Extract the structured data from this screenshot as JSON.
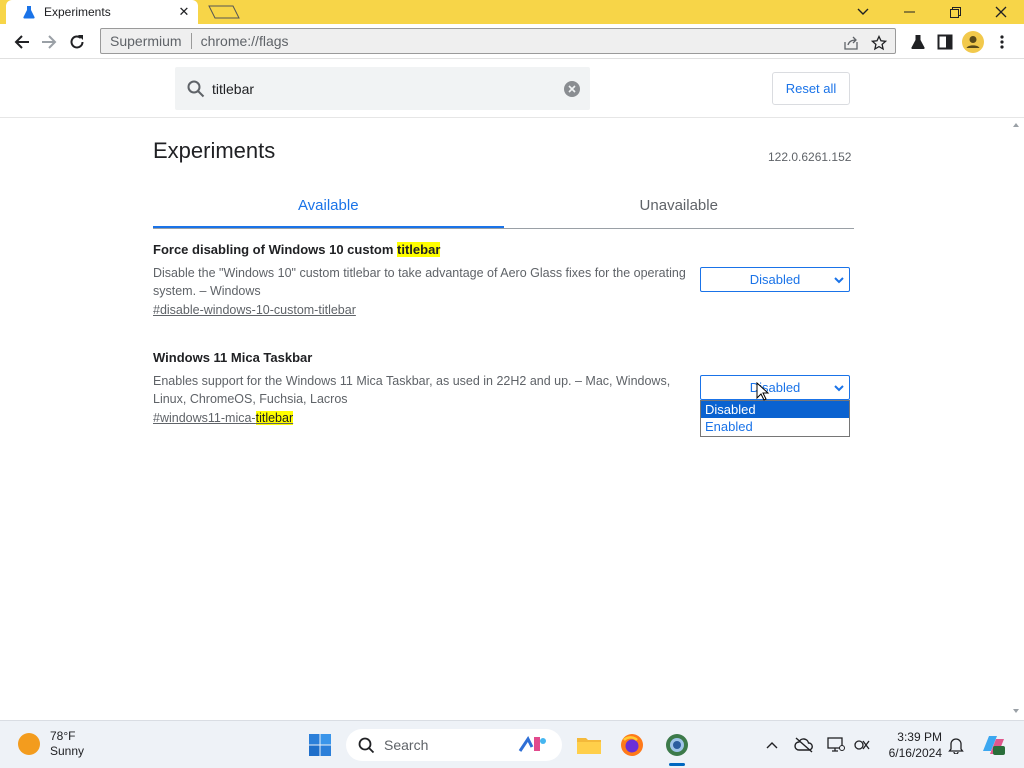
{
  "browser": {
    "tab_title": "Experiments",
    "omnibox_site": "Supermium",
    "omnibox_url": "chrome://flags"
  },
  "search": {
    "value": "titlebar",
    "reset_label": "Reset all"
  },
  "page": {
    "title": "Experiments",
    "version": "122.0.6261.152",
    "tabs": [
      {
        "label": "Available"
      },
      {
        "label": "Unavailable"
      }
    ]
  },
  "flags": [
    {
      "name_prefix": "Force disabling of Windows 10 custom ",
      "name_highlight": "titlebar",
      "description": "Disable the \"Windows 10\" custom titlebar to take advantage of Aero Glass fixes for the operating system. – Windows",
      "link": "#disable-windows-10-custom-titlebar",
      "select_value": "Disabled"
    },
    {
      "name": "Windows 11 Mica Taskbar",
      "description": "Enables support for the Windows 11 Mica Taskbar, as used in 22H2 and up. – Mac, Windows, Linux, ChromeOS, Fuchsia, Lacros",
      "link_prefix": "#windows11-mica-",
      "link_highlight": "titlebar",
      "select_value": "Disabled",
      "dropdown_options": [
        {
          "label": "Disabled",
          "selected": true
        },
        {
          "label": "Enabled",
          "selected": false
        }
      ]
    }
  ],
  "taskbar": {
    "weather_temp": "78°F",
    "weather_desc": "Sunny",
    "search_placeholder": "Search",
    "time": "3:39 PM",
    "date": "6/16/2024"
  },
  "colors": {
    "titlebar": "#f7d548",
    "accent": "#1a73e8",
    "highlight": "#ffff00",
    "dropdown_selected": "#0a62d0"
  }
}
